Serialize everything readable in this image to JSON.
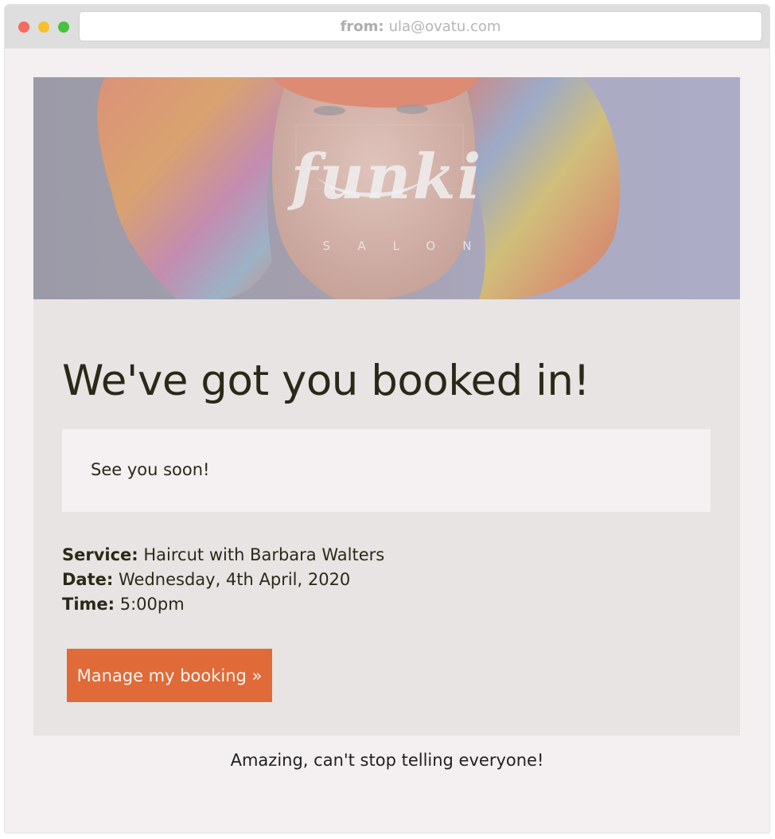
{
  "window": {
    "address_label": "from:",
    "address_value": "ula@ovatu.com"
  },
  "hero": {
    "brand_name": "funki",
    "brand_sub": "SALON"
  },
  "email": {
    "headline": "We've got you booked in!",
    "note": "See you soon!",
    "details": [
      {
        "label": "Service:",
        "value": "Haircut with Barbara Walters"
      },
      {
        "label": "Date:",
        "value": "Wednesday, 4th April, 2020"
      },
      {
        "label": "Time:",
        "value": "5:00pm"
      }
    ],
    "button_label": "Manage my booking »",
    "button_color": "#e06a38",
    "testimonial": "Amazing, can't stop telling everyone!"
  }
}
